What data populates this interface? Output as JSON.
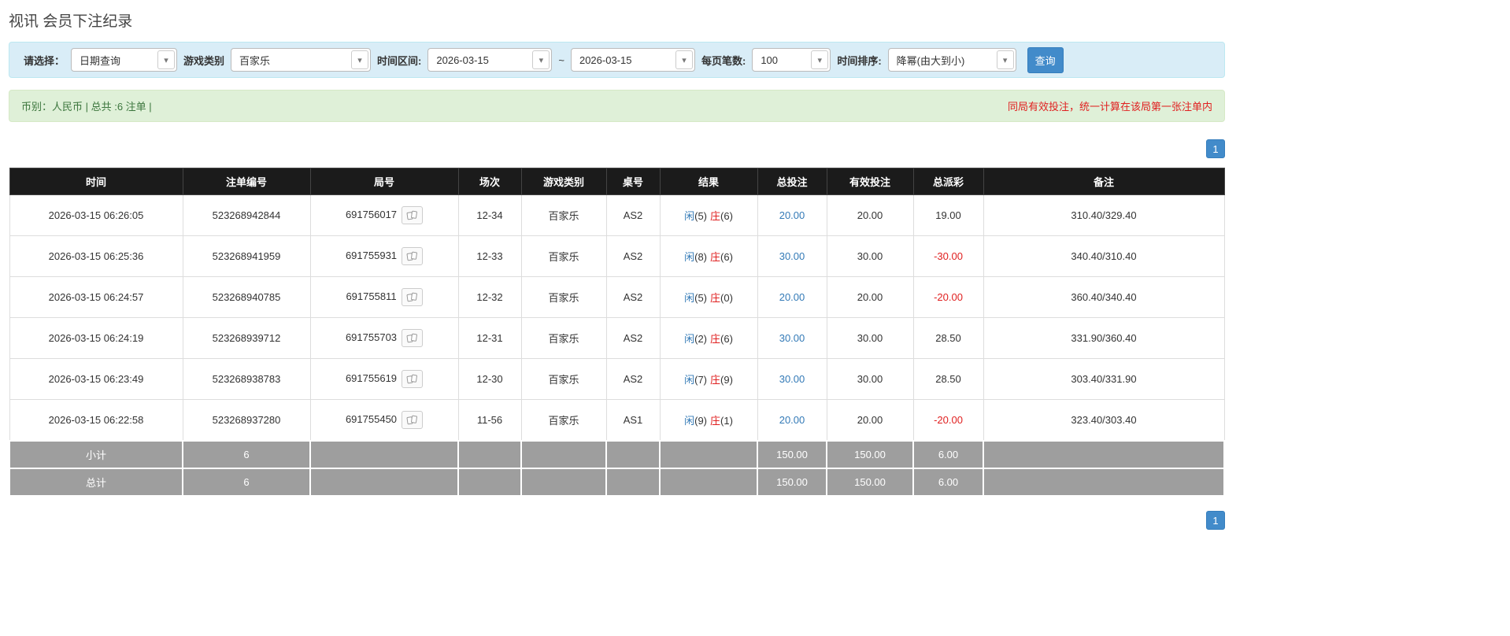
{
  "colors": {
    "accent": "#428bca",
    "accent-border": "#357ebd",
    "link-blue": "#337ab7",
    "red": "#e02020",
    "filter-bg": "#d9edf7",
    "filter-border": "#bce8f1",
    "info-bg": "#dff0d8",
    "info-border": "#d6e9c6",
    "info-text": "#3c763d",
    "header-bg": "#1b1b1b",
    "summary-bg": "#9e9e9e"
  },
  "icons": {
    "caret_down": "▾"
  },
  "page": {
    "title": "视讯 会员下注纪录"
  },
  "filters": {
    "select_label": "请选择：",
    "select_value": "日期查询",
    "game_type_label": "游戏类别",
    "game_type_value": "百家乐",
    "time_range_label": "时间区间:",
    "date_from": "2026-03-15",
    "range_separator": "~",
    "date_to": "2026-03-15",
    "page_size_label": "每页笔数:",
    "page_size_value": "100",
    "sort_label": "时间排序:",
    "sort_value": "降幂(由大到小)",
    "search_button_label": "查询"
  },
  "info_bar": {
    "summary": "币别：人民币 | 总共 :6 注单 |",
    "notice": "同局有效投注，统一计算在该局第一张注单内"
  },
  "pagination": {
    "current_page": "1"
  },
  "table": {
    "headers": [
      "时间",
      "注单编号",
      "局号",
      "场次",
      "游戏类别",
      "桌号",
      "结果",
      "总投注",
      "有效投注",
      "总派彩",
      "备注"
    ],
    "rows": [
      {
        "time": "2026-03-15 06:26:05",
        "bet_id": "523268942844",
        "round_id": "691756017",
        "session": "12-34",
        "game_type": "百家乐",
        "table_no": "AS2",
        "result_player_label": "闲",
        "result_player_value": "(5)",
        "result_banker_label": "庄",
        "result_banker_value": "(6)",
        "total_bet": "20.00",
        "valid_bet": "20.00",
        "payout": "19.00",
        "note": "310.40/329.40"
      },
      {
        "time": "2026-03-15 06:25:36",
        "bet_id": "523268941959",
        "round_id": "691755931",
        "session": "12-33",
        "game_type": "百家乐",
        "table_no": "AS2",
        "result_player_label": "闲",
        "result_player_value": "(8)",
        "result_banker_label": "庄",
        "result_banker_value": "(6)",
        "total_bet": "30.00",
        "valid_bet": "30.00",
        "payout": "-30.00",
        "note": "340.40/310.40"
      },
      {
        "time": "2026-03-15 06:24:57",
        "bet_id": "523268940785",
        "round_id": "691755811",
        "session": "12-32",
        "game_type": "百家乐",
        "table_no": "AS2",
        "result_player_label": "闲",
        "result_player_value": "(5)",
        "result_banker_label": "庄",
        "result_banker_value": "(0)",
        "total_bet": "20.00",
        "valid_bet": "20.00",
        "payout": "-20.00",
        "note": "360.40/340.40"
      },
      {
        "time": "2026-03-15 06:24:19",
        "bet_id": "523268939712",
        "round_id": "691755703",
        "session": "12-31",
        "game_type": "百家乐",
        "table_no": "AS2",
        "result_player_label": "闲",
        "result_player_value": "(2)",
        "result_banker_label": "庄",
        "result_banker_value": "(6)",
        "total_bet": "30.00",
        "valid_bet": "30.00",
        "payout": "28.50",
        "note": "331.90/360.40"
      },
      {
        "time": "2026-03-15 06:23:49",
        "bet_id": "523268938783",
        "round_id": "691755619",
        "session": "12-30",
        "game_type": "百家乐",
        "table_no": "AS2",
        "result_player_label": "闲",
        "result_player_value": "(7)",
        "result_banker_label": "庄",
        "result_banker_value": "(9)",
        "total_bet": "30.00",
        "valid_bet": "30.00",
        "payout": "28.50",
        "note": "303.40/331.90"
      },
      {
        "time": "2026-03-15 06:22:58",
        "bet_id": "523268937280",
        "round_id": "691755450",
        "session": "11-56",
        "game_type": "百家乐",
        "table_no": "AS1",
        "result_player_label": "闲",
        "result_player_value": "(9)",
        "result_banker_label": "庄",
        "result_banker_value": "(1)",
        "total_bet": "20.00",
        "valid_bet": "20.00",
        "payout": "-20.00",
        "note": "323.40/303.40"
      }
    ],
    "summary_rows": [
      {
        "label": "小计",
        "count": "6",
        "total_bet": "150.00",
        "valid_bet": "150.00",
        "payout": "6.00"
      },
      {
        "label": "总计",
        "count": "6",
        "total_bet": "150.00",
        "valid_bet": "150.00",
        "payout": "6.00"
      }
    ]
  }
}
